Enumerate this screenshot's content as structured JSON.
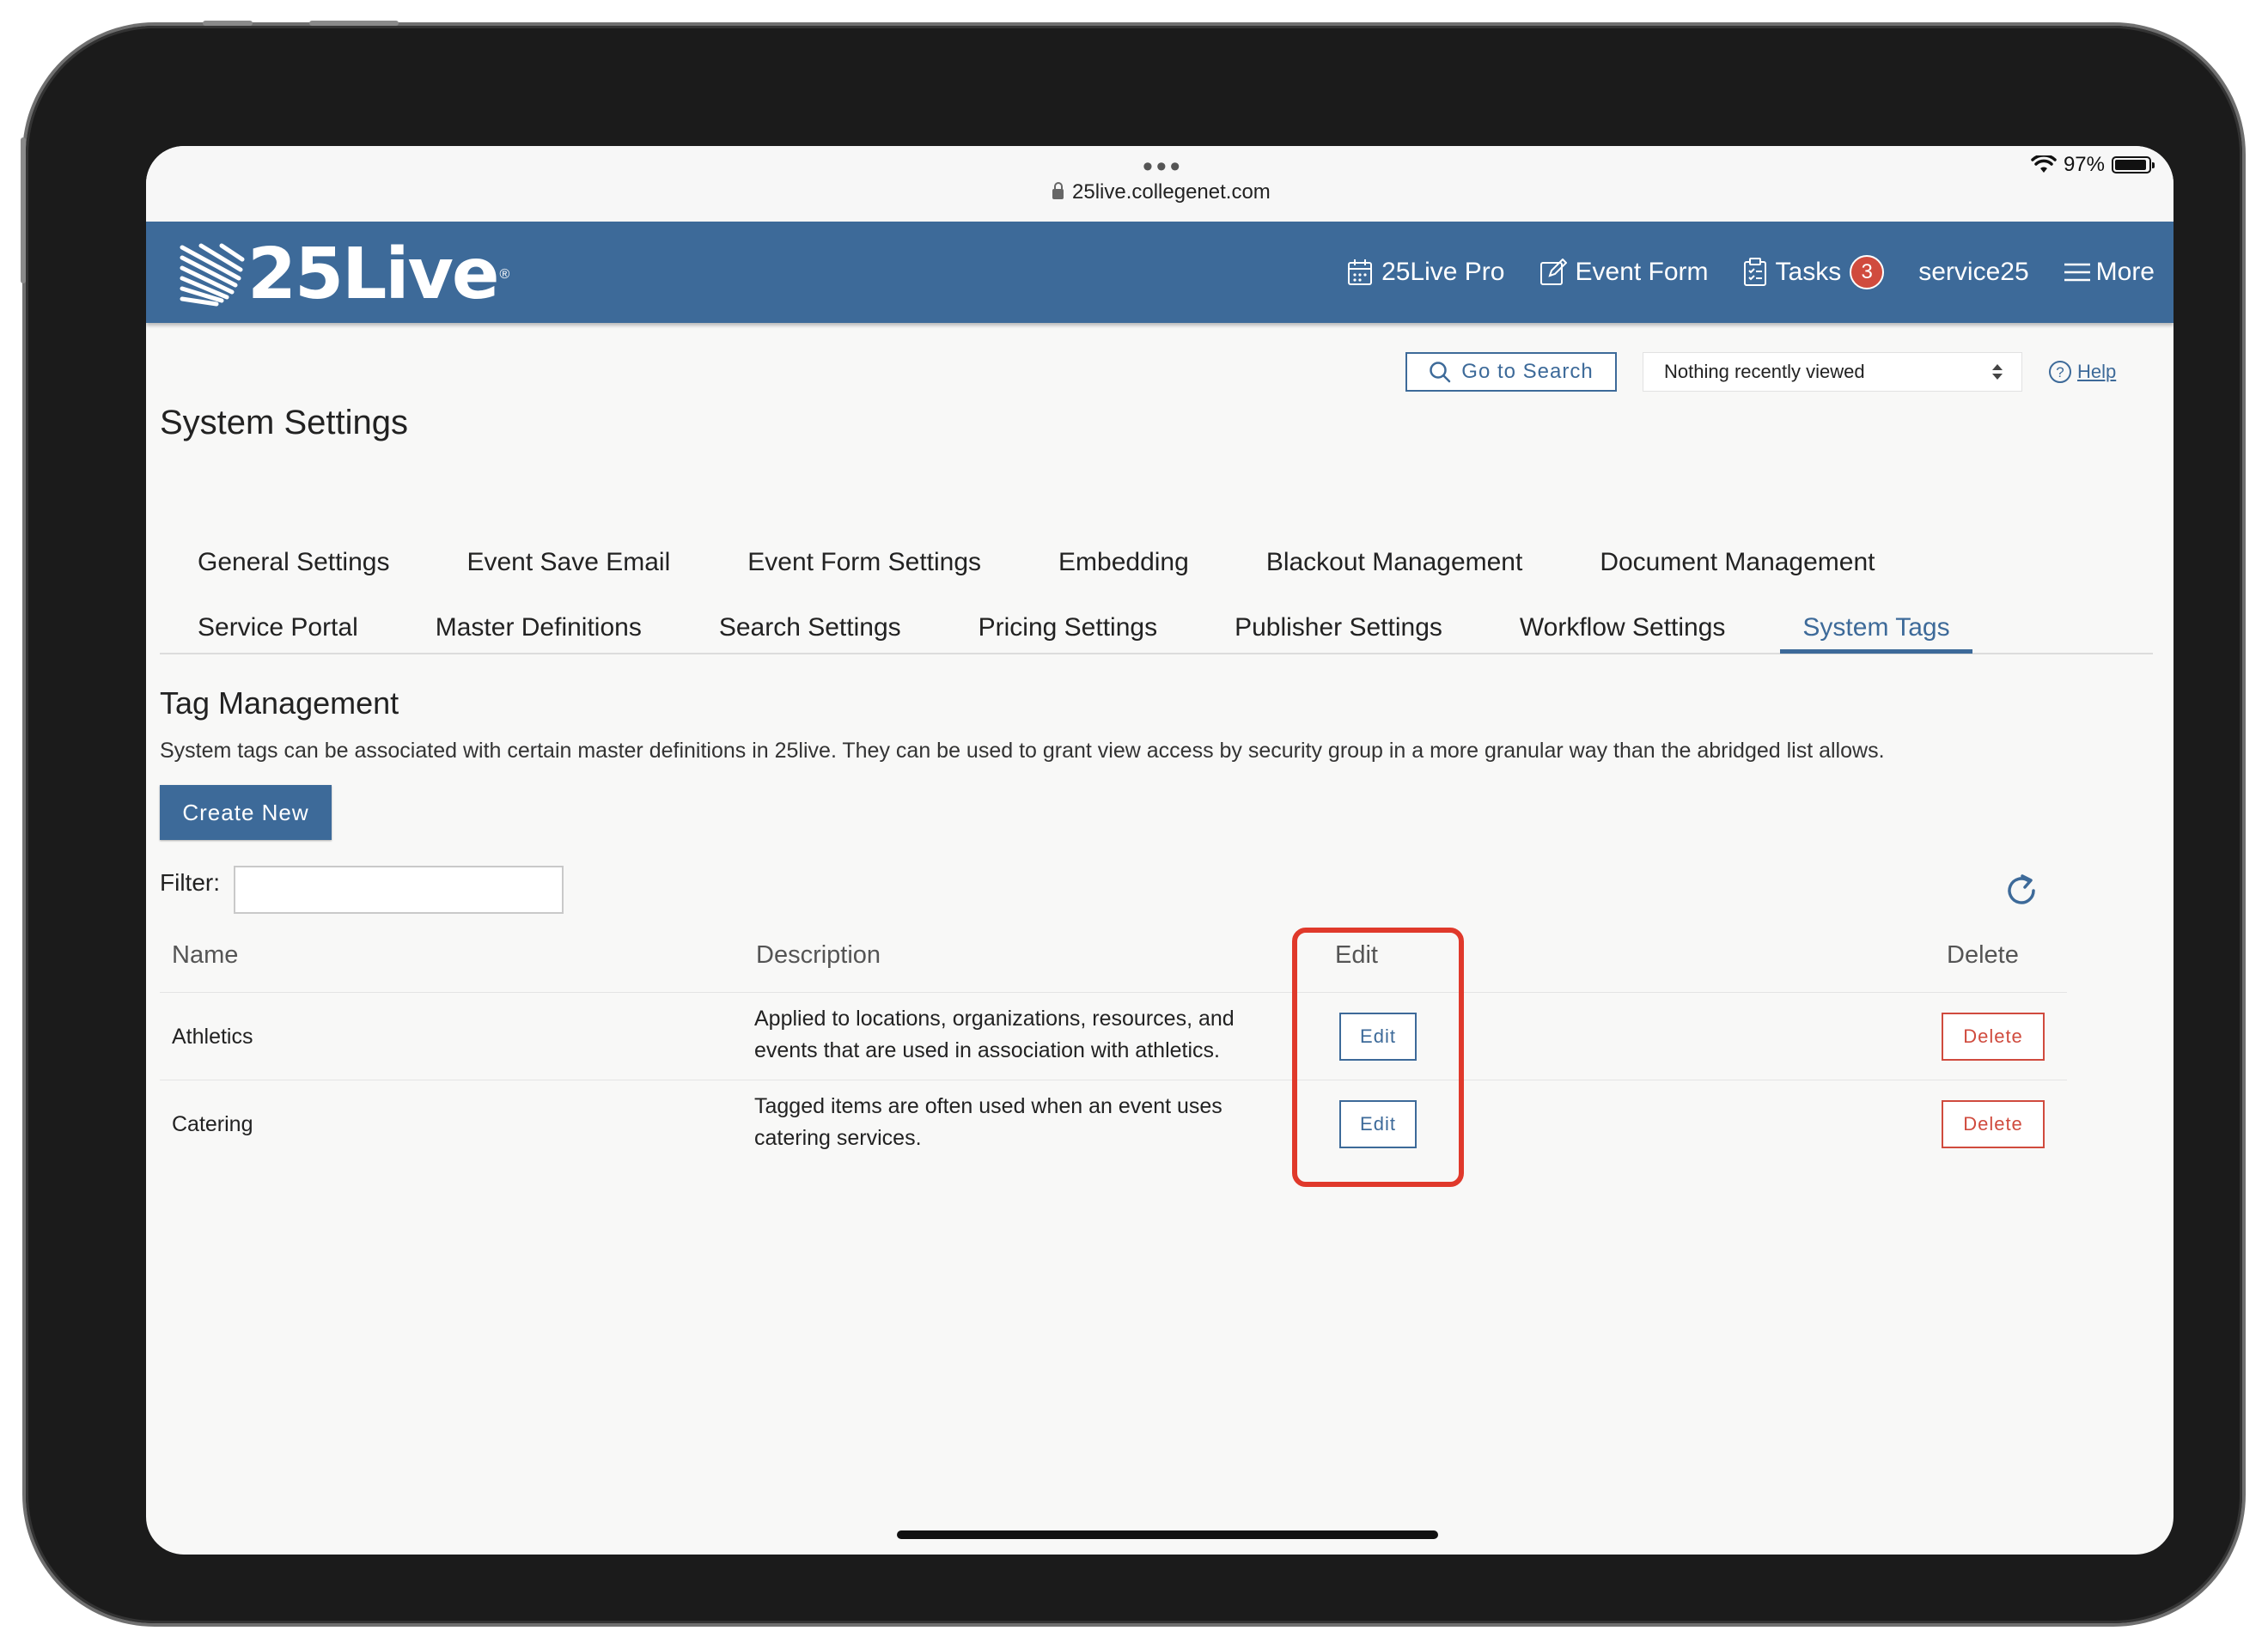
{
  "browser": {
    "url": "25live.collegenet.com",
    "battery": "97%"
  },
  "nav": {
    "logo": "25Live",
    "links": [
      {
        "label": "25Live Pro"
      },
      {
        "label": "Event Form"
      },
      {
        "label": "Tasks",
        "badge": "3"
      },
      {
        "label": "service25"
      },
      {
        "label": "More"
      }
    ]
  },
  "toolbar": {
    "go_to_search": "Go to Search",
    "recently_viewed": "Nothing recently viewed",
    "help": "Help"
  },
  "page": {
    "title": "System Settings"
  },
  "tabs": {
    "row1": [
      "General Settings",
      "Event Save Email",
      "Event Form Settings",
      "Embedding",
      "Blackout Management",
      "Document Management"
    ],
    "row2": [
      "Service Portal",
      "Master Definitions",
      "Search Settings",
      "Pricing Settings",
      "Publisher Settings",
      "Workflow Settings",
      "System Tags"
    ],
    "active": "System Tags"
  },
  "section": {
    "title": "Tag Management",
    "description": "System tags can be associated with certain master definitions in 25live. They can be used to grant view access by security group in a more granular way than the abridged list allows.",
    "create_label": "Create New",
    "filter_label": "Filter:",
    "filter_value": ""
  },
  "table": {
    "columns": [
      "Name",
      "Description",
      "Edit",
      "Delete"
    ],
    "rows": [
      {
        "name": "Athletics",
        "description_line1": "Applied to locations, organizations, resources, and",
        "description_line2": "events that are used in association with athletics.",
        "edit_label": "Edit",
        "delete_label": "Delete"
      },
      {
        "name": "Catering",
        "description_line1": "Tagged items are often used when an event uses",
        "description_line2": "catering services.",
        "edit_label": "Edit",
        "delete_label": "Delete"
      }
    ]
  },
  "colors": {
    "brand": "#3d6a99",
    "danger": "#d04b3e",
    "highlight": "#e0392b"
  }
}
